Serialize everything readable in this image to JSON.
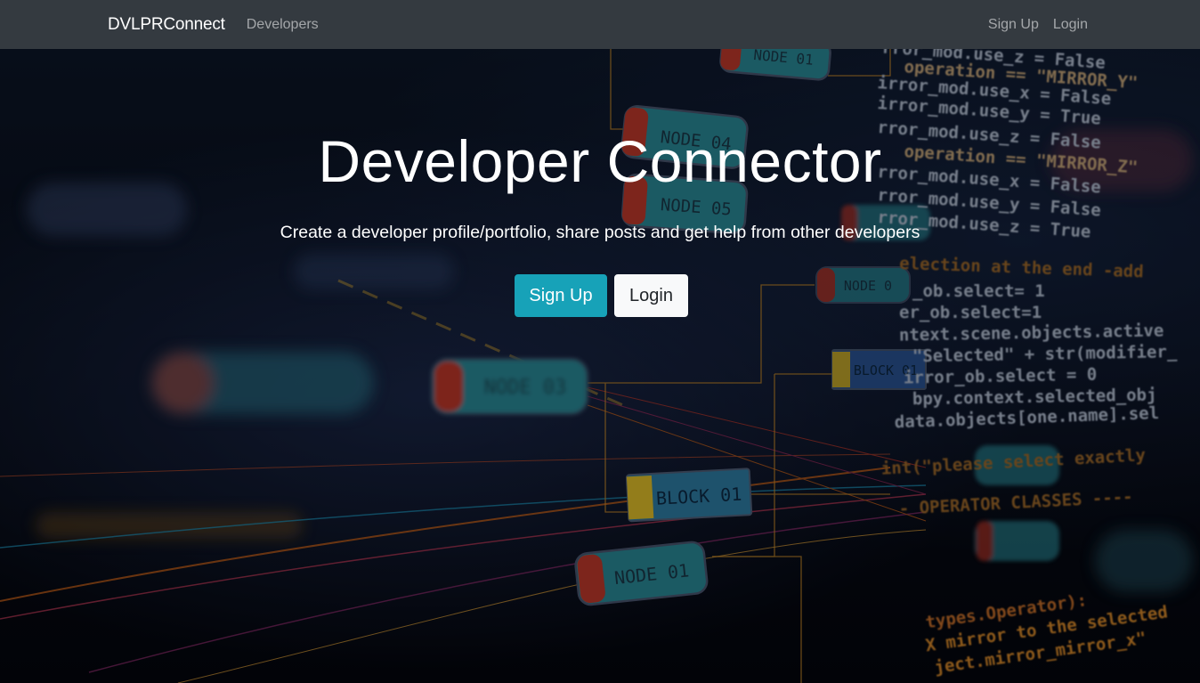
{
  "navbar": {
    "brand": "DVLPRConnect",
    "developers_link": "Developers",
    "signup_link": "Sign Up",
    "login_link": "Login"
  },
  "hero": {
    "title": "Developer Connector",
    "lead": "Create a developer profile/portfolio, share posts and get help from other developers",
    "signup_button": "Sign Up",
    "login_button": "Login"
  },
  "background": {
    "nodes": [
      "NODE 01",
      "BLOCK 01",
      "NODE 03",
      "NODE 04",
      "NODE 05",
      "BLOCK 01",
      "NODE 01",
      "NODE 01"
    ],
    "code_lines": [
      "rror_mod.use_z = False",
      "operation == \"MIRROR_Y\"",
      "irror_mod.use_x = False",
      "irror_mod.use_y = True",
      "rror_mod.use_z = False",
      "operation == \"MIRROR_Z\"",
      "rror_mod.use_x = False",
      "rror_mod.use_y = False",
      "rror_mod.use_z = True",
      "election at the end -add",
      "_ob.select= 1",
      "er_ob.select=1",
      "ntext.scene.objects.active",
      "\"Selected\" + str(modifier_",
      "irror_ob.select = 0",
      "bpy.context.selected_obj",
      "data.objects[one.name].sel",
      "int(\"please select exactly",
      "- OPERATOR CLASSES ----",
      "types.Operator):",
      "X mirror to the selected",
      "ject.mirror_mirror_x\""
    ]
  },
  "colors": {
    "navbar_bg": "#343a40",
    "primary_button": "#17a2b8",
    "light_button": "#f8f9fa"
  }
}
